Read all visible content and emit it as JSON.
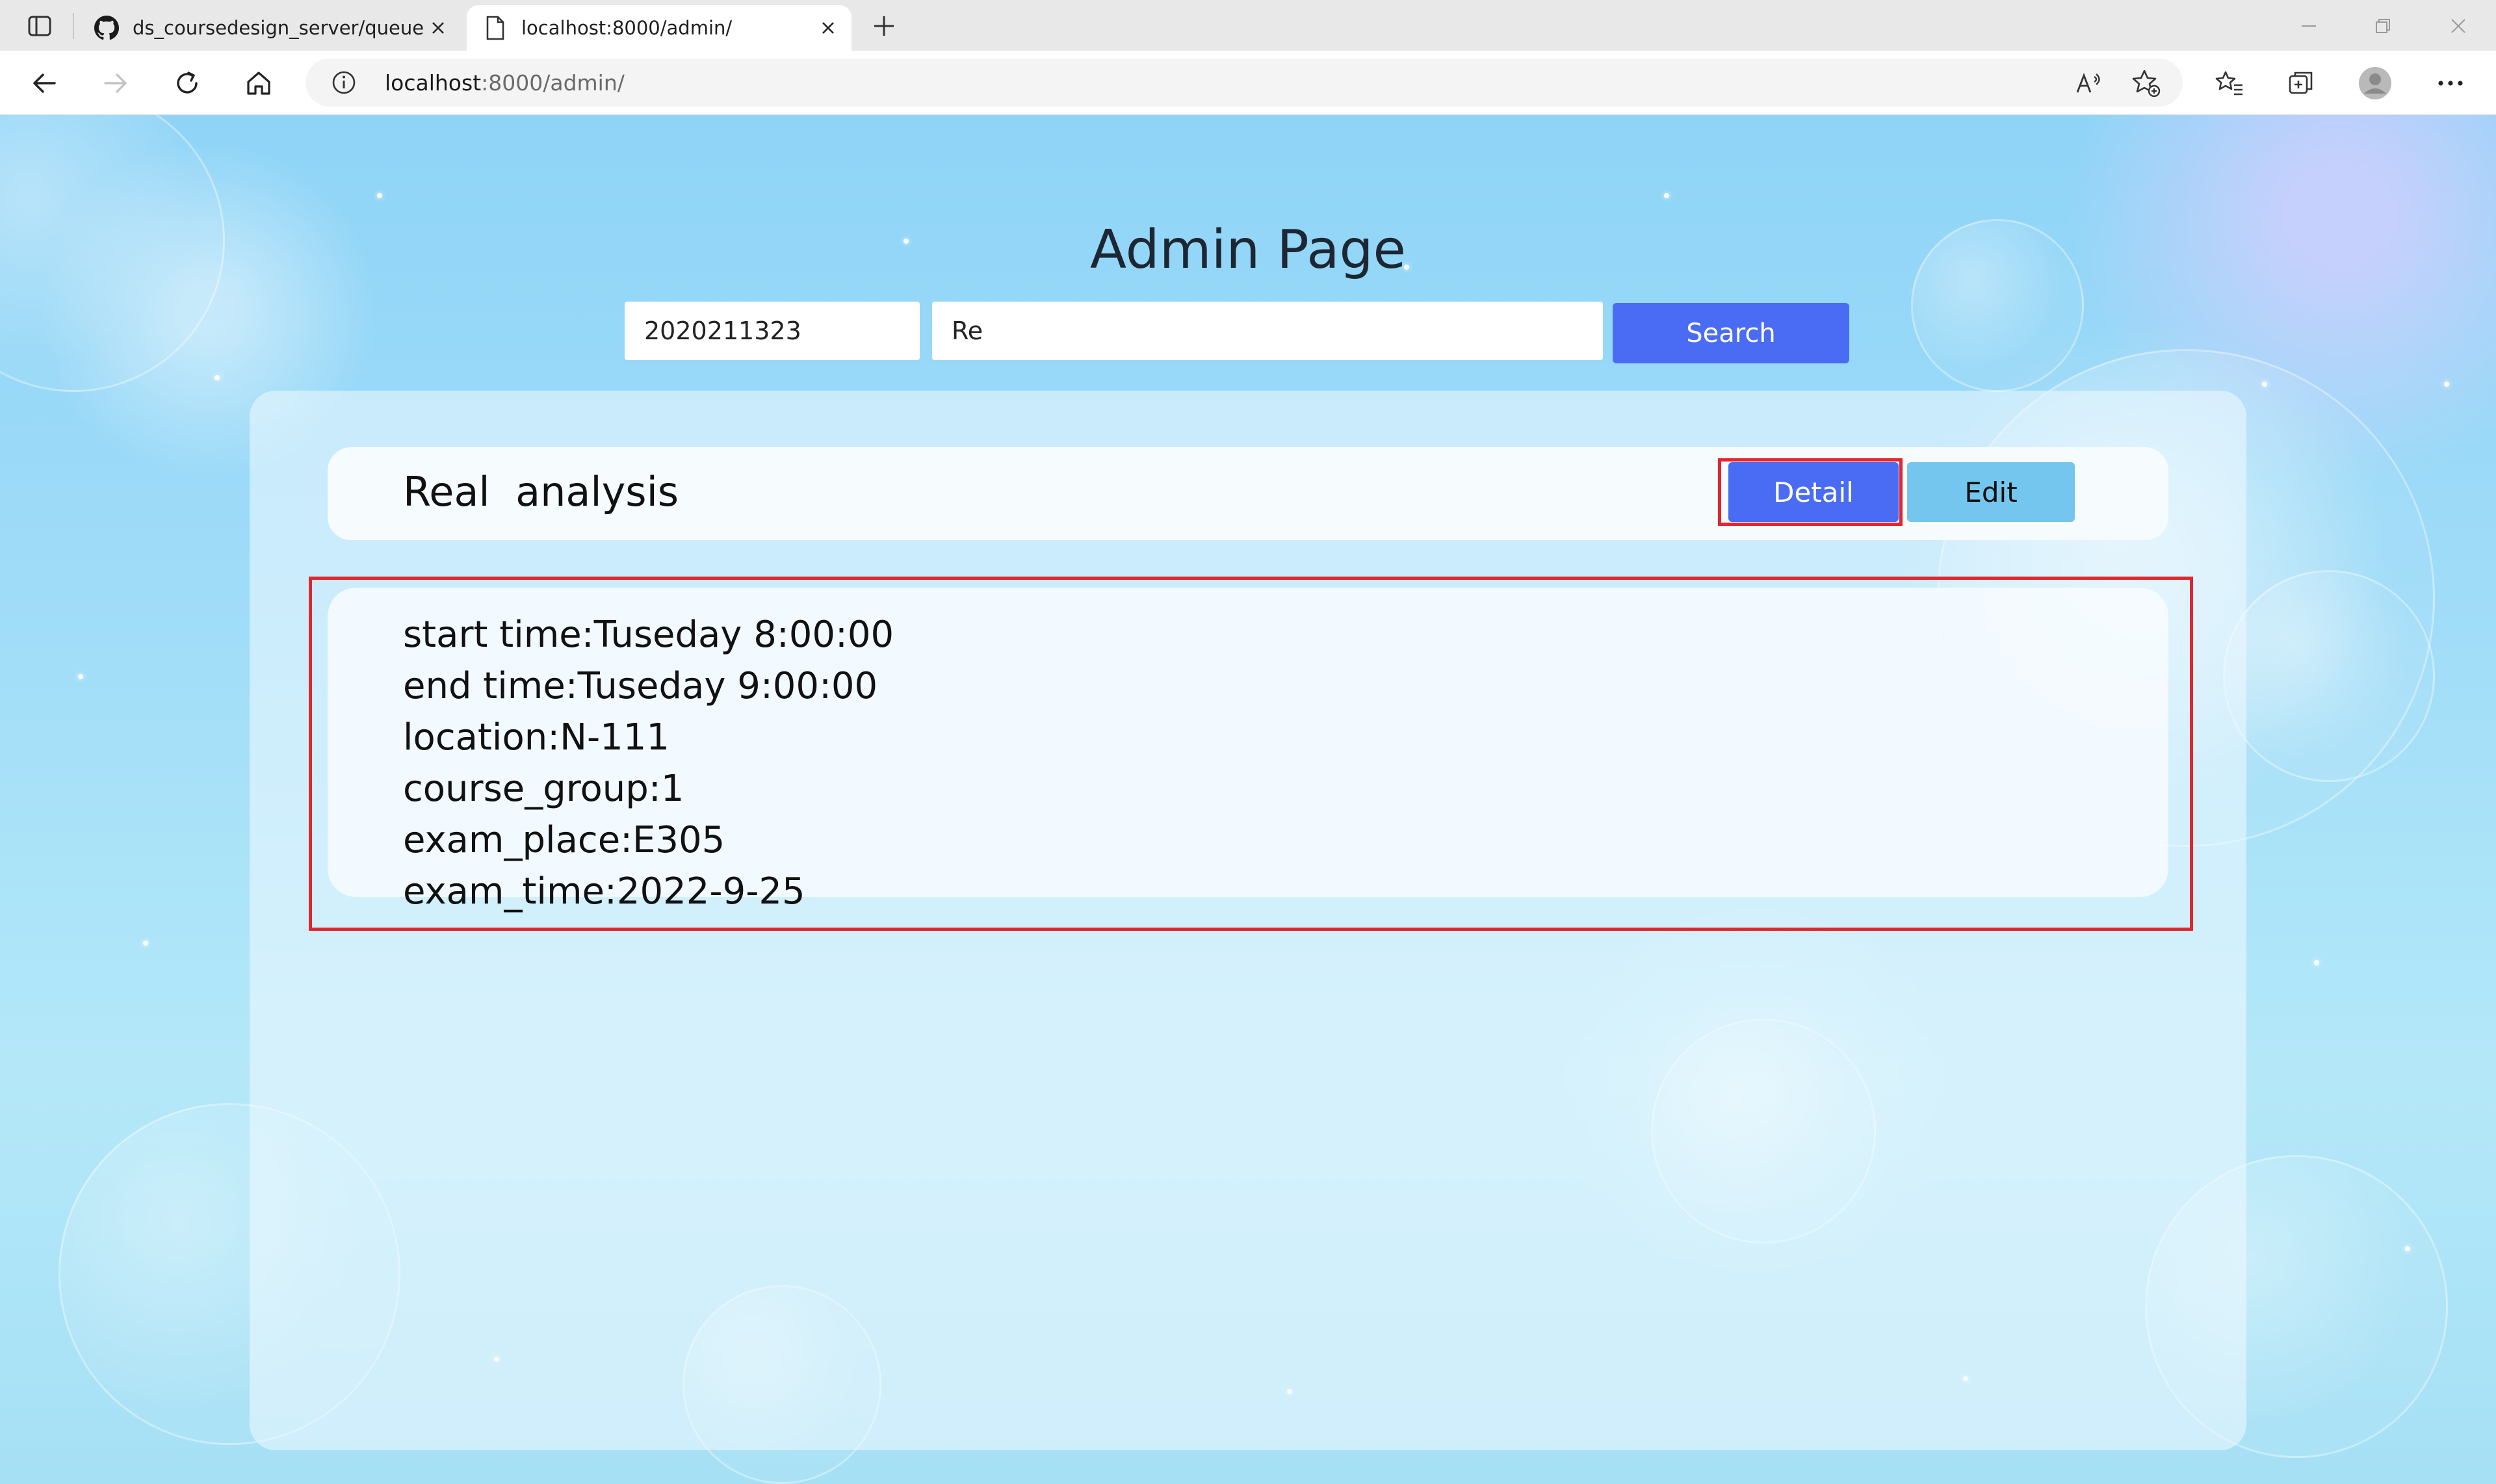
{
  "browser": {
    "tabs": [
      {
        "title": "ds_coursedesign_server/queue.p",
        "icon": "github-icon",
        "active": false
      },
      {
        "title": "localhost:8000/admin/",
        "icon": "page-icon",
        "active": true
      }
    ],
    "address": {
      "host": "localhost",
      "rest": ":8000/admin/"
    }
  },
  "page": {
    "title": "Admin Page",
    "search": {
      "id_value": "2020211323",
      "course_value": "Re",
      "button_label": "Search"
    },
    "course": {
      "name": "Real  analysis",
      "detail_label": "Detail",
      "edit_label": "Edit",
      "details": [
        "start time:Tuseday 8:00:00",
        "end time:Tuseday 9:00:00",
        "location:N-111",
        "course_group:1",
        "exam_place:E305",
        "exam_time:2022-9-25"
      ]
    }
  },
  "colors": {
    "accent": "#4a6cf4",
    "edit_button": "#74c6ee",
    "highlight": "#e0262e"
  }
}
